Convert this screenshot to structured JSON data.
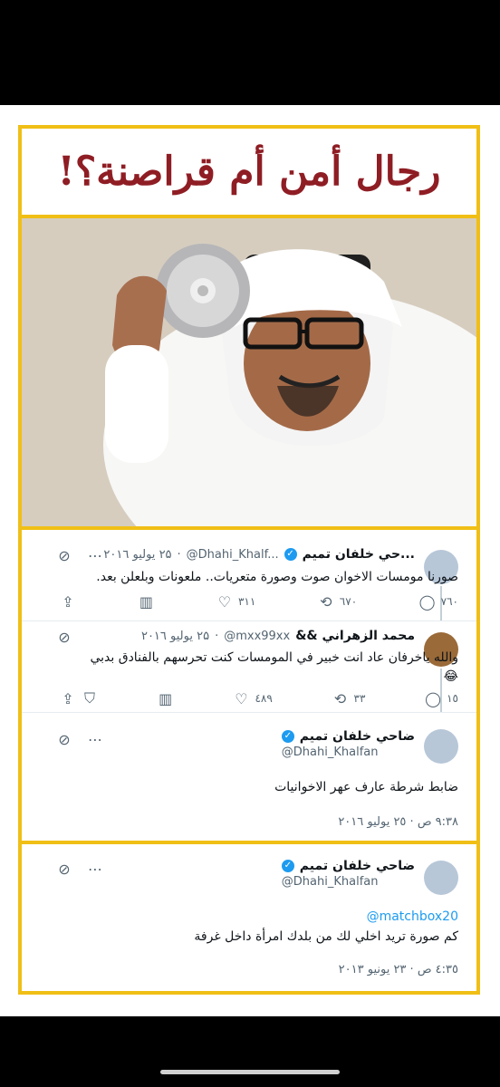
{
  "headline": "رجال أمن أم قراصنة؟!",
  "tweets": [
    {
      "name": "...حي خلفان تميم",
      "handle": "@Dhahi_Khalf...",
      "date": "۲۵ يوليو ۲۰۱٦",
      "text": "صورنا مومسات الاخوان صوت وصورة متعريات.. ملعونات وبلعلن بعد.",
      "replies": "٧٦٠",
      "retweets": "٦٧٠",
      "likes": "۳۱۱"
    },
    {
      "name": "محمد الزهراني &&",
      "handle": "@mxx99xx",
      "date": "۲۵ يوليو ۲۰۱٦",
      "text": "والله ياخرفان عاد انت خبير في المومسات كنت تحرسهم بالفنادق بدبي 😂",
      "replies": "١٥",
      "retweets": "۳۳",
      "likes": "٤٨٩"
    },
    {
      "name": "ضاحي خلفان تميم",
      "handle": "@Dhahi_Khalfan",
      "text": "ضابط شرطة عارف عهر الاخوانيات",
      "timestamp": "٩:٣٨ ص · ٢٥ يوليو ٢٠١٦"
    },
    {
      "name": "ضاحي خلفان تميم",
      "handle": "@Dhahi_Khalfan",
      "mention": "@matchbox20",
      "text": "كم صورة تريد اخلي لك من بلدك امرأة داخل غرفة",
      "timestamp": "٤:٣٥ ص · ٢٣ يونيو ٢٠١٣"
    }
  ],
  "icons": {
    "more": "more-icon",
    "link": "link-off-icon",
    "reply": "reply-icon",
    "retweet": "retweet-icon",
    "like": "heart-icon",
    "views": "views-icon",
    "share": "share-icon",
    "bookmark": "bookmark-icon"
  },
  "colors": {
    "accent": "#1d9bf0",
    "frame": "#f0bf16",
    "headline": "#8f1d24"
  }
}
